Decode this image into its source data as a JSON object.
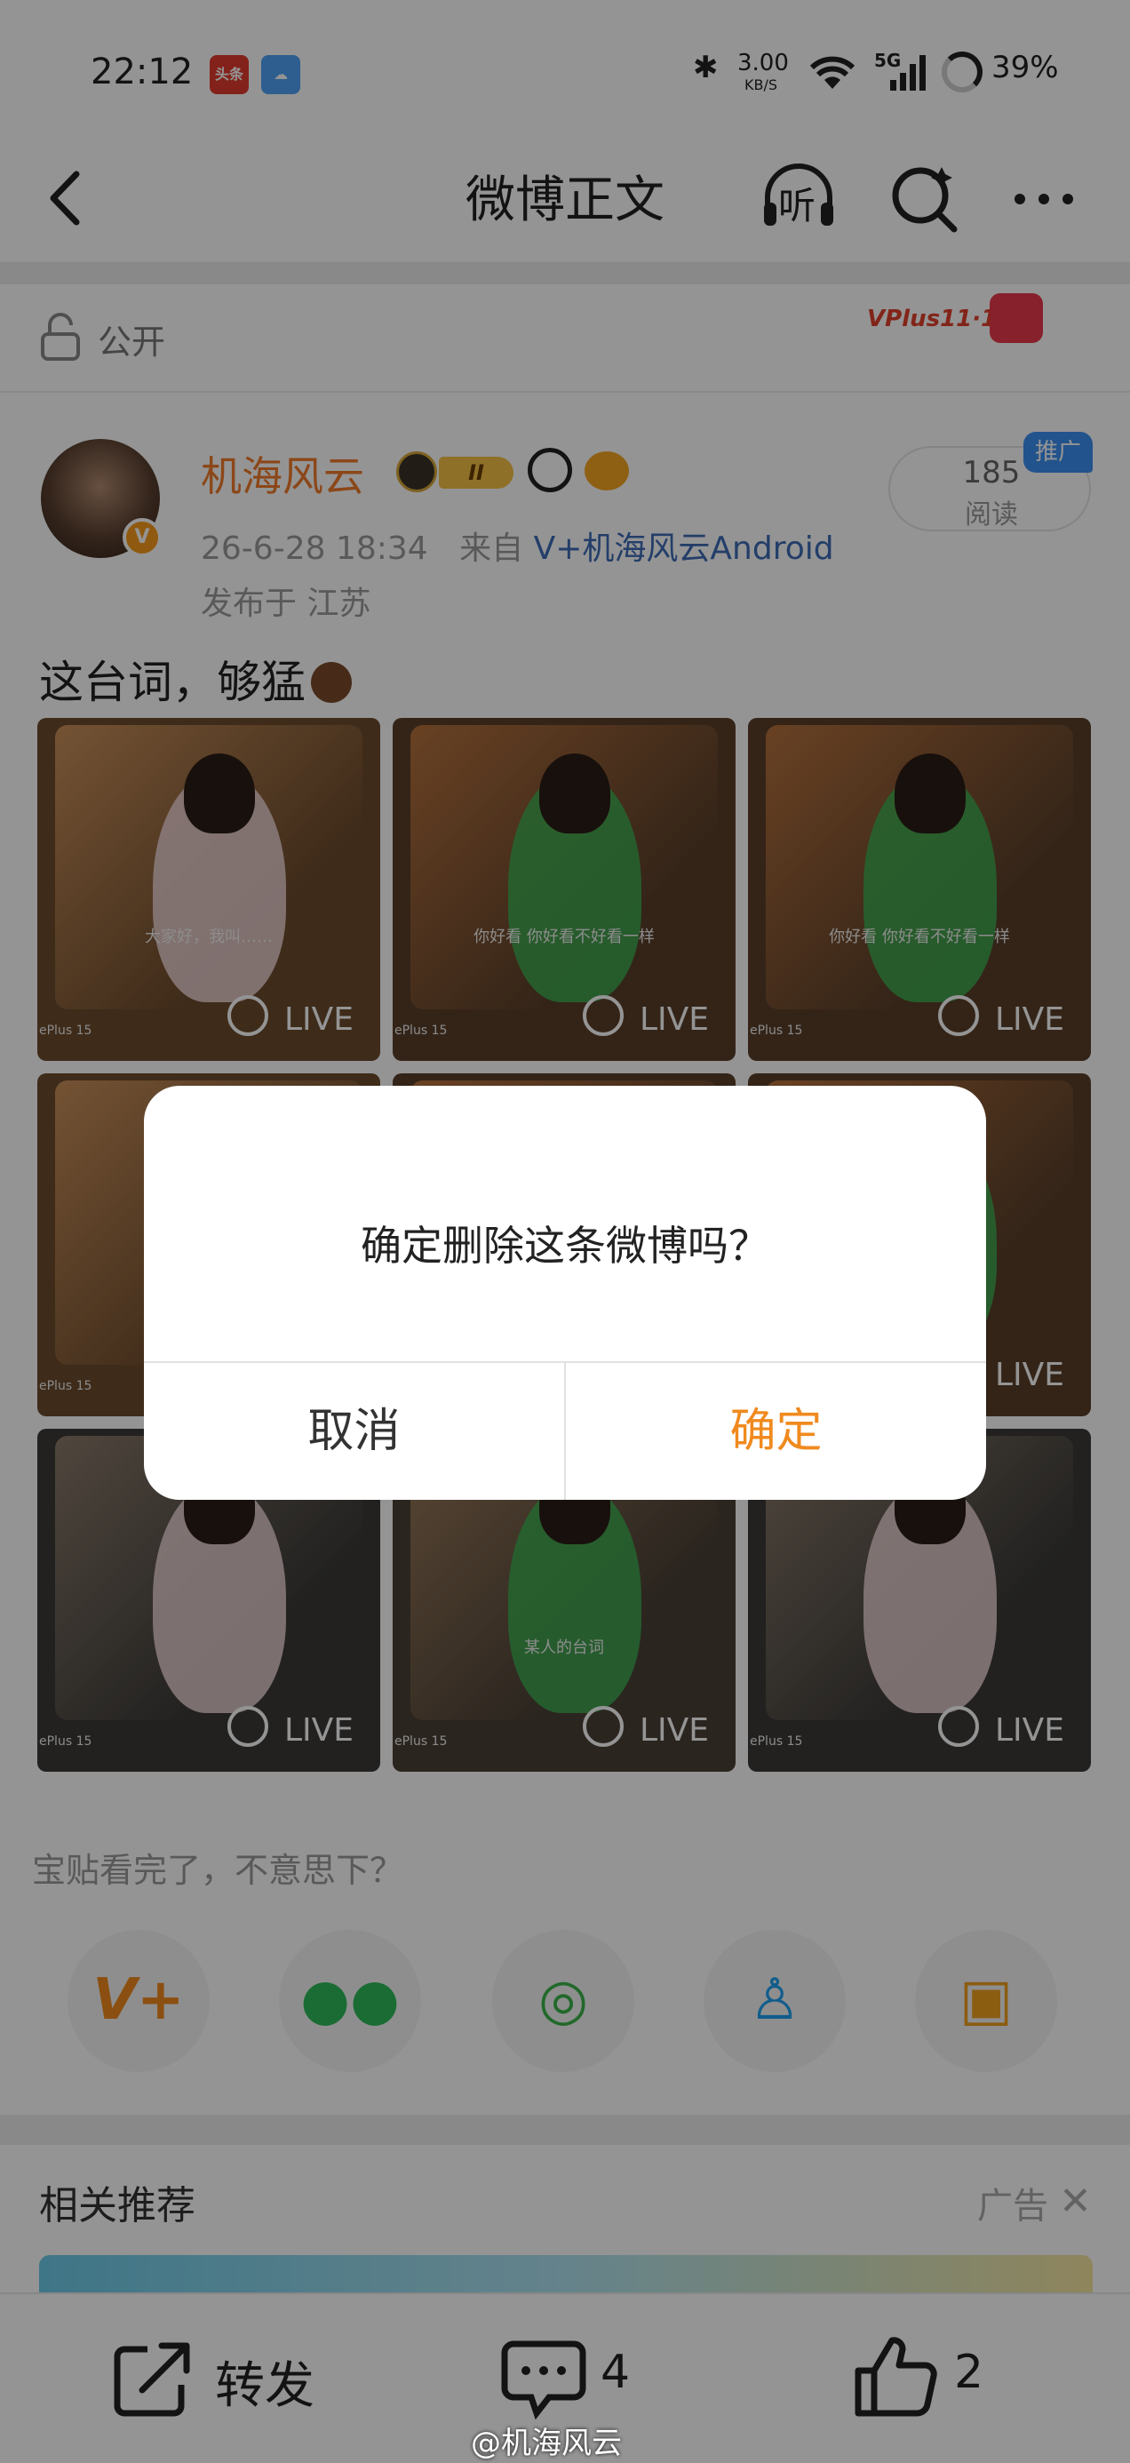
{
  "status_bar": {
    "time": "22:12",
    "net_speed": "3.00",
    "net_unit": "KB/S",
    "network": "5G",
    "battery": "39%",
    "app_badge_1": "头条"
  },
  "nav": {
    "title": "微博正文",
    "listen_label": "听"
  },
  "privacy": {
    "label": "公开",
    "event_badge": "VPlus11·11"
  },
  "post": {
    "username": "机海风云",
    "level_badge": "II",
    "time": "26-6-28 18:34",
    "source_prefix": "来自",
    "source": "V+机海风云Android",
    "location": "发布于 江苏",
    "reads_count": "185",
    "reads_label": "阅读",
    "promo_tag": "推广",
    "text": "这台词，够猛",
    "live_label": "LIVE",
    "brand_mark": "ePlus 15",
    "subtitles": [
      "大家好，我叫……",
      "你好看  你好看不好看一样",
      "你好看  你好看不好看一样",
      "",
      "",
      "",
      "",
      "某人的台词",
      ""
    ]
  },
  "share": {
    "hint": "宝贴看完了，不意思下？",
    "buttons": [
      "v-plus",
      "wechat",
      "moments",
      "qq",
      "save-image"
    ]
  },
  "related": {
    "title": "相关推荐",
    "ad_label": "广告"
  },
  "bottom_bar": {
    "repost_label": "转发",
    "comment_count": "4",
    "like_count": "2"
  },
  "watermark": "@机海风云",
  "dialog": {
    "message": "确定删除这条微博吗？",
    "cancel": "取消",
    "confirm": "确定",
    "confirm_color": "#f08a1e"
  }
}
